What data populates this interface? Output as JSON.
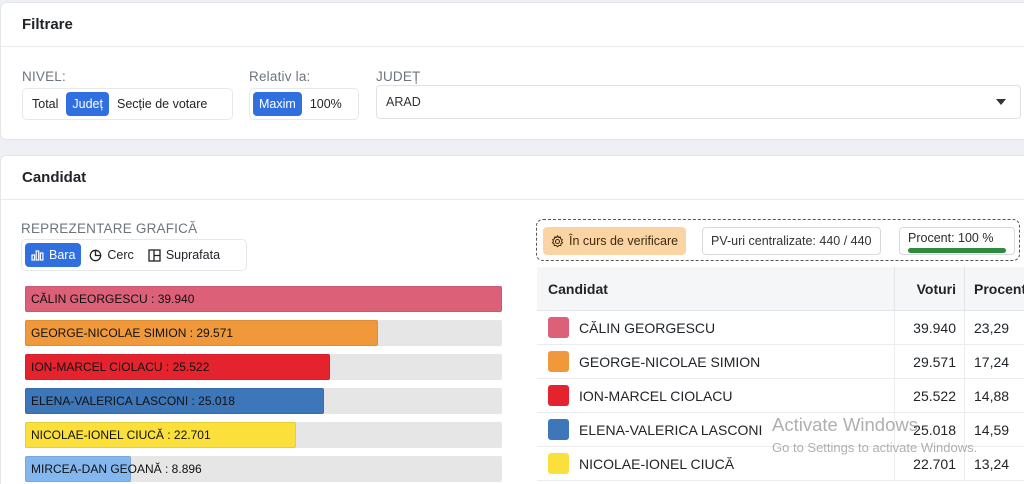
{
  "filter": {
    "title": "Filtrare",
    "level_label": "NIVEL:",
    "level_options": [
      "Total",
      "Județ",
      "Secție de votare"
    ],
    "relative_label": "Relativ la:",
    "relative_options": [
      "Maxim",
      "100%"
    ],
    "county_label": "JUDEȚ",
    "county_value": "ARAD"
  },
  "candidate_section": {
    "title": "Candidat",
    "graph_label": "REPREZENTARE GRAFICĂ",
    "graph_options": [
      "Bara",
      "Cerc",
      "Suprafata"
    ]
  },
  "bars": [
    {
      "label": "CĂLIN GEORGESCU : 39.940",
      "value": 39940,
      "color": "#db6078"
    },
    {
      "label": "GEORGE-NICOLAE SIMION : 29.571",
      "value": 29571,
      "color": "#f0993a"
    },
    {
      "label": "ION-MARCEL CIOLACU : 25.522",
      "value": 25522,
      "color": "#e5232f"
    },
    {
      "label": "ELENA-VALERICA LASCONI : 25.018",
      "value": 25018,
      "color": "#3d76b9"
    },
    {
      "label": "NICOLAE-IONEL CIUCĂ : 22.701",
      "value": 22701,
      "color": "#fbdf3b"
    },
    {
      "label": "MIRCEA-DAN GEOANĂ : 8.896",
      "value": 8896,
      "color": "#84b7ee"
    }
  ],
  "status": {
    "verification": "În curs de verificare",
    "pv": "PV-uri centralizate: 440 / 440",
    "percent": "Procent: 100 %"
  },
  "table": {
    "headers": [
      "Candidat",
      "Voturi",
      "Procent"
    ],
    "rows": [
      {
        "name": "CĂLIN GEORGESCU",
        "votes": "39.940",
        "pct": "23,29",
        "color": "#db6078"
      },
      {
        "name": "GEORGE-NICOLAE SIMION",
        "votes": "29.571",
        "pct": "17,24",
        "color": "#f0993a"
      },
      {
        "name": "ION-MARCEL CIOLACU",
        "votes": "25.522",
        "pct": "14,88",
        "color": "#e5232f"
      },
      {
        "name": "ELENA-VALERICA LASCONI",
        "votes": "25.018",
        "pct": "14,59",
        "color": "#3d76b9"
      },
      {
        "name": "NICOLAE-IONEL CIUCĂ",
        "votes": "22.701",
        "pct": "13,24",
        "color": "#fbdf3b"
      }
    ]
  },
  "watermark": {
    "line1": "Activate Windows",
    "line2": "Go to Settings to activate Windows."
  }
}
